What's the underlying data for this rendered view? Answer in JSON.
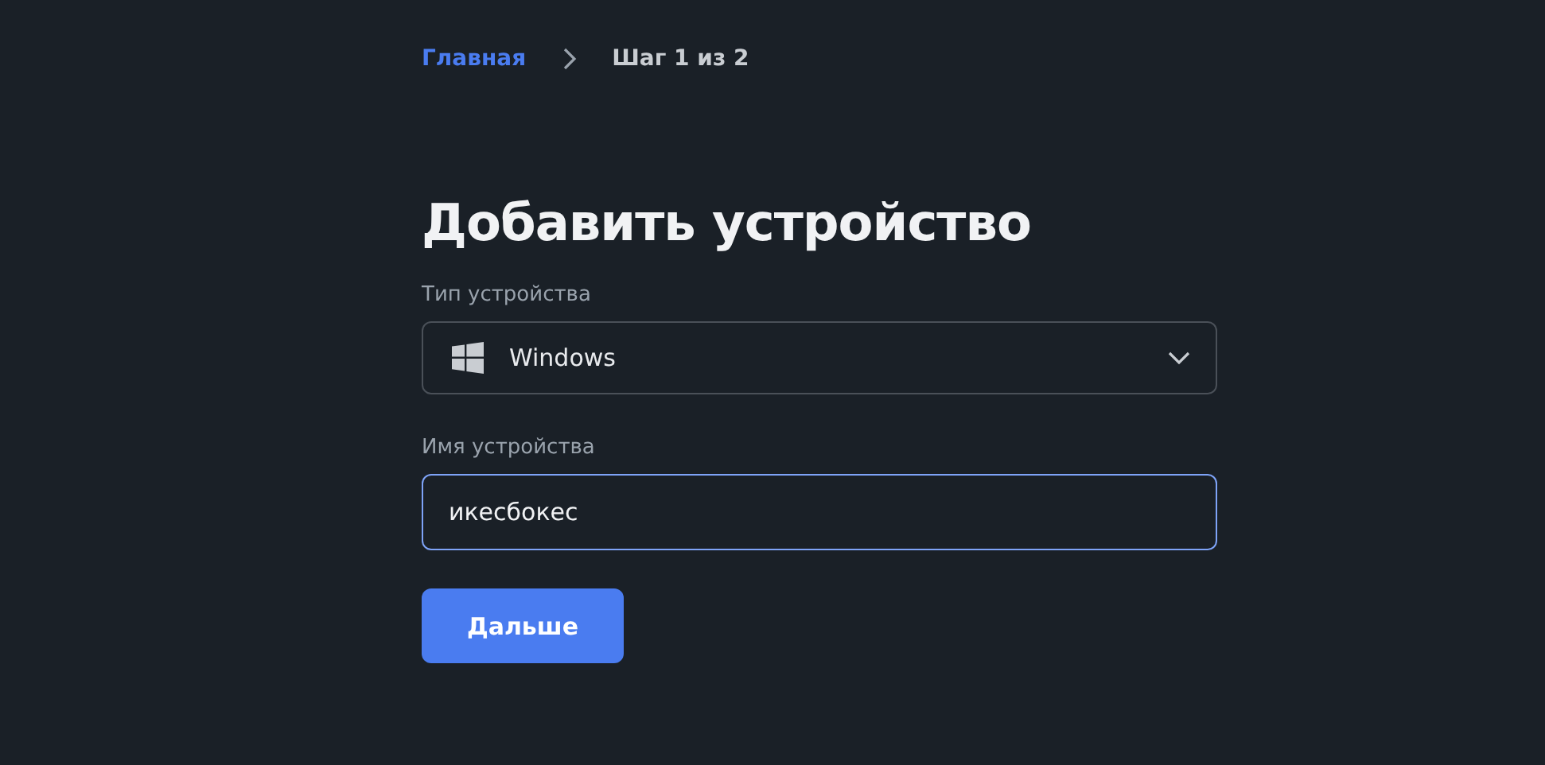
{
  "breadcrumb": [
    {
      "label": "Главная",
      "kind": "link"
    },
    {
      "label": "Шаг 1 из 2",
      "kind": "current"
    }
  ],
  "title": "Добавить устройство",
  "device_type": {
    "label": "Тип устройства",
    "value": "Windows"
  },
  "device_name": {
    "label": "Имя устройства",
    "value": "икесбокес",
    "focused": true
  },
  "next_button": "Дальше"
}
